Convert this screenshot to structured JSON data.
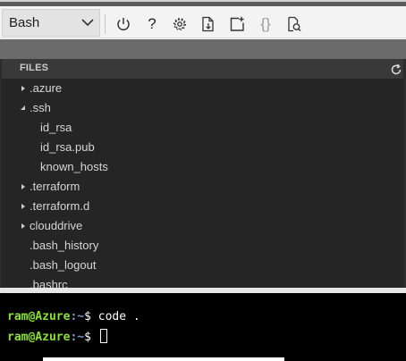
{
  "toolbar": {
    "shell_value": "Bash",
    "buttons": [
      {
        "name": "restart",
        "icon": "power-icon"
      },
      {
        "name": "help",
        "icon": "question-icon",
        "glyph": "?"
      },
      {
        "name": "settings",
        "icon": "gear-icon"
      },
      {
        "name": "upload-download",
        "icon": "file-transfer-icon"
      },
      {
        "name": "new-session",
        "icon": "new-session-icon"
      },
      {
        "name": "editor",
        "icon": "braces-icon",
        "glyph": "{}"
      },
      {
        "name": "web-preview",
        "icon": "web-preview-icon"
      }
    ]
  },
  "explorer": {
    "title": "FILES",
    "refresh_icon": "refresh-icon",
    "items": [
      {
        "label": ".azure",
        "type": "folder",
        "expanded": false,
        "depth": 0
      },
      {
        "label": ".ssh",
        "type": "folder",
        "expanded": true,
        "depth": 0
      },
      {
        "label": "id_rsa",
        "type": "file",
        "depth": 1
      },
      {
        "label": "id_rsa.pub",
        "type": "file",
        "depth": 1
      },
      {
        "label": "known_hosts",
        "type": "file",
        "depth": 1
      },
      {
        "label": ".terraform",
        "type": "folder",
        "expanded": false,
        "depth": 0
      },
      {
        "label": ".terraform.d",
        "type": "folder",
        "expanded": false,
        "depth": 0
      },
      {
        "label": "clouddrive",
        "type": "folder",
        "expanded": false,
        "depth": 0
      },
      {
        "label": ".bash_history",
        "type": "file",
        "depth": 0
      },
      {
        "label": ".bash_logout",
        "type": "file",
        "depth": 0
      },
      {
        "label": ".bashrc",
        "type": "file",
        "depth": 0
      }
    ]
  },
  "terminal": {
    "lines": [
      {
        "user": "ram@Azure",
        "path": ":~",
        "tail": "$ ",
        "command": "code ."
      },
      {
        "user": "ram@Azure",
        "path": ":~",
        "tail": "$ ",
        "command": ""
      }
    ]
  },
  "colors": {
    "prompt_user": "#8ae234",
    "prompt_path": "#729fcf",
    "explorer_bg": "#252526",
    "toolbar_bg": "#f3f3f3"
  }
}
